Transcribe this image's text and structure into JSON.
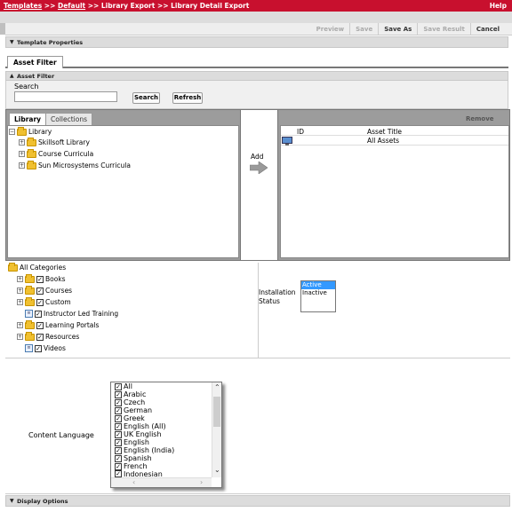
{
  "breadcrumb": {
    "templates": "Templates",
    "sep1": " >> ",
    "default": "Default",
    "rest": " >> Library Export >> Library Detail Export"
  },
  "help_label": "Help",
  "toolbar": {
    "preview": "Preview",
    "save": "Save",
    "save_as": "Save As",
    "save_result": "Save Result",
    "cancel": "Cancel"
  },
  "sections": {
    "template_properties": "Template Properties",
    "asset_filter_tab": "Asset Filter",
    "asset_filter": "Asset Filter",
    "display_options": "Display Options"
  },
  "search": {
    "label": "Search",
    "value": "",
    "search_btn": "Search",
    "refresh_btn": "Refresh"
  },
  "library_tabs": {
    "library": "Library",
    "collections": "Collections"
  },
  "library_tree": [
    {
      "label": "Library"
    },
    {
      "label": "Skillsoft Library"
    },
    {
      "label": "Course Curricula"
    },
    {
      "label": "Sun Microsystems Curricula"
    }
  ],
  "add_label": "Add",
  "selected": {
    "remove": "Remove",
    "col_id": "ID",
    "col_title": "Asset Title",
    "rows": [
      {
        "id": "",
        "title": "All Assets"
      }
    ]
  },
  "categories": {
    "root": "All Categories",
    "items": [
      {
        "label": "Books",
        "kind": "folder"
      },
      {
        "label": "Courses",
        "kind": "folder"
      },
      {
        "label": "Custom",
        "kind": "folder"
      },
      {
        "label": "Instructor Led Training",
        "kind": "doc"
      },
      {
        "label": "Learning Portals",
        "kind": "folder"
      },
      {
        "label": "Resources",
        "kind": "folder"
      },
      {
        "label": "Videos",
        "kind": "doc"
      }
    ]
  },
  "installation": {
    "label_line1": "Installation",
    "label_line2": "Status",
    "options": [
      "Active",
      "Inactive"
    ],
    "selected": "Active"
  },
  "content_language": {
    "label": "Content Language",
    "options": [
      "All",
      "Arabic",
      "Czech",
      "German",
      "Greek",
      "English (All)",
      "UK English",
      "English",
      "English (India)",
      "Spanish",
      "French",
      "Indonesian"
    ]
  },
  "colors": {
    "topbar": "#c8102e",
    "selection": "#3399ff",
    "panel": "#9c9c9c"
  }
}
